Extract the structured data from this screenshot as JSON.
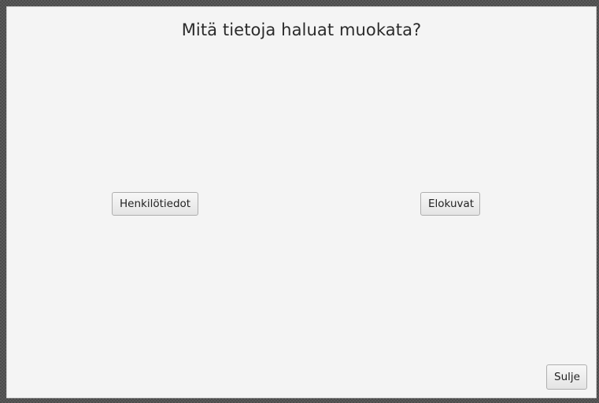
{
  "dialog": {
    "question": "Mitä tietoja haluat muokata?"
  },
  "buttons": {
    "personal_info": "Henkilötiedot",
    "movies": "Elokuvat",
    "close": "Sulje"
  }
}
